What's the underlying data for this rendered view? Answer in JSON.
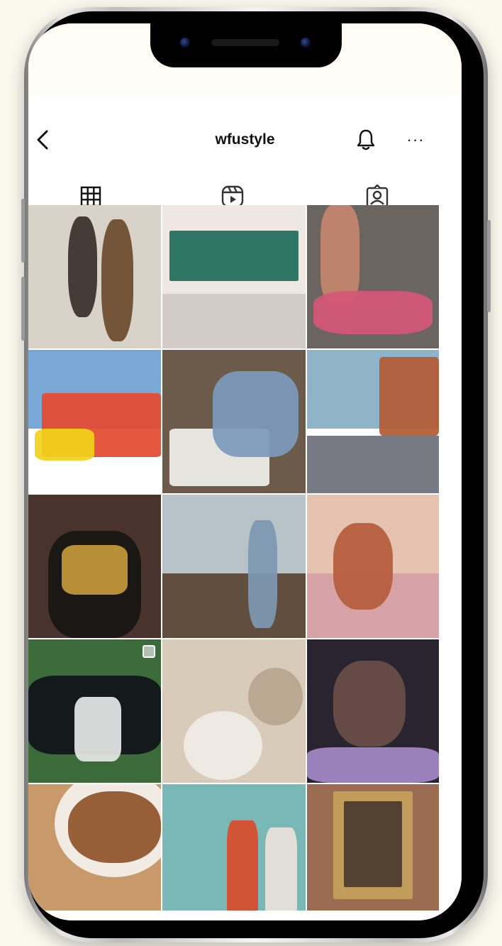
{
  "profile": {
    "username": "wfustyle"
  },
  "icons": {
    "back": "chevron-left-icon",
    "notifications": "bell-icon",
    "more": "more-horizontal-icon",
    "tab_grid": "grid-icon",
    "tab_reels": "reels-icon",
    "tab_tagged": "tagged-user-icon"
  },
  "header": {
    "more_label": "···"
  },
  "tabs": [
    {
      "id": "posts",
      "icon": "grid-icon",
      "active": true
    },
    {
      "id": "reels",
      "icon": "reels-icon",
      "active": false
    },
    {
      "id": "tagged",
      "icon": "tagged-user-icon",
      "active": false
    }
  ],
  "posts": [
    {
      "id": "post-1",
      "palette": [
        "#d8d2c8",
        "#3a2f2a",
        "#6b4a2c"
      ],
      "multi": false
    },
    {
      "id": "post-2",
      "palette": [
        "#efe8e2",
        "#1f6b59",
        "#cfc8c6"
      ],
      "multi": false
    },
    {
      "id": "post-3",
      "palette": [
        "#6a6561",
        "#c4866f",
        "#d55777"
      ],
      "multi": false
    },
    {
      "id": "post-4",
      "palette": [
        "#7aa7d6",
        "#e4492f",
        "#f2d21b"
      ],
      "multi": false
    },
    {
      "id": "post-5",
      "palette": [
        "#6c5a4a",
        "#f1f0ec",
        "#7d99bb"
      ],
      "multi": false
    },
    {
      "id": "post-6",
      "palette": [
        "#8fb3c9",
        "#b35a33",
        "#6b6f78"
      ],
      "multi": false
    },
    {
      "id": "post-7",
      "palette": [
        "#4a332c",
        "#171514",
        "#c39a3a"
      ],
      "multi": false
    },
    {
      "id": "post-8",
      "palette": [
        "#b8c2c9",
        "#5a4432",
        "#7d98b2"
      ],
      "multi": false
    },
    {
      "id": "post-9",
      "palette": [
        "#e6c2b0",
        "#d6a1a6",
        "#b45c3c"
      ],
      "multi": false
    },
    {
      "id": "post-10",
      "palette": [
        "#3b6a3b",
        "#111419",
        "#e7e7e7"
      ],
      "multi": true
    },
    {
      "id": "post-11",
      "palette": [
        "#d9cbb9",
        "#f1ece6",
        "#b9a58f"
      ],
      "multi": false
    },
    {
      "id": "post-12",
      "palette": [
        "#2a2430",
        "#6a4e49",
        "#a48ac8"
      ],
      "multi": false
    },
    {
      "id": "post-13",
      "palette": [
        "#c89a6b",
        "#f4f2ee",
        "#8e5228"
      ],
      "multi": false
    },
    {
      "id": "post-14",
      "palette": [
        "#7ab7b7",
        "#d84b2a",
        "#e7e2da"
      ],
      "multi": false
    },
    {
      "id": "post-15",
      "palette": [
        "#9b6b52",
        "#c5a15c",
        "#4a3a2f"
      ],
      "multi": false
    }
  ]
}
